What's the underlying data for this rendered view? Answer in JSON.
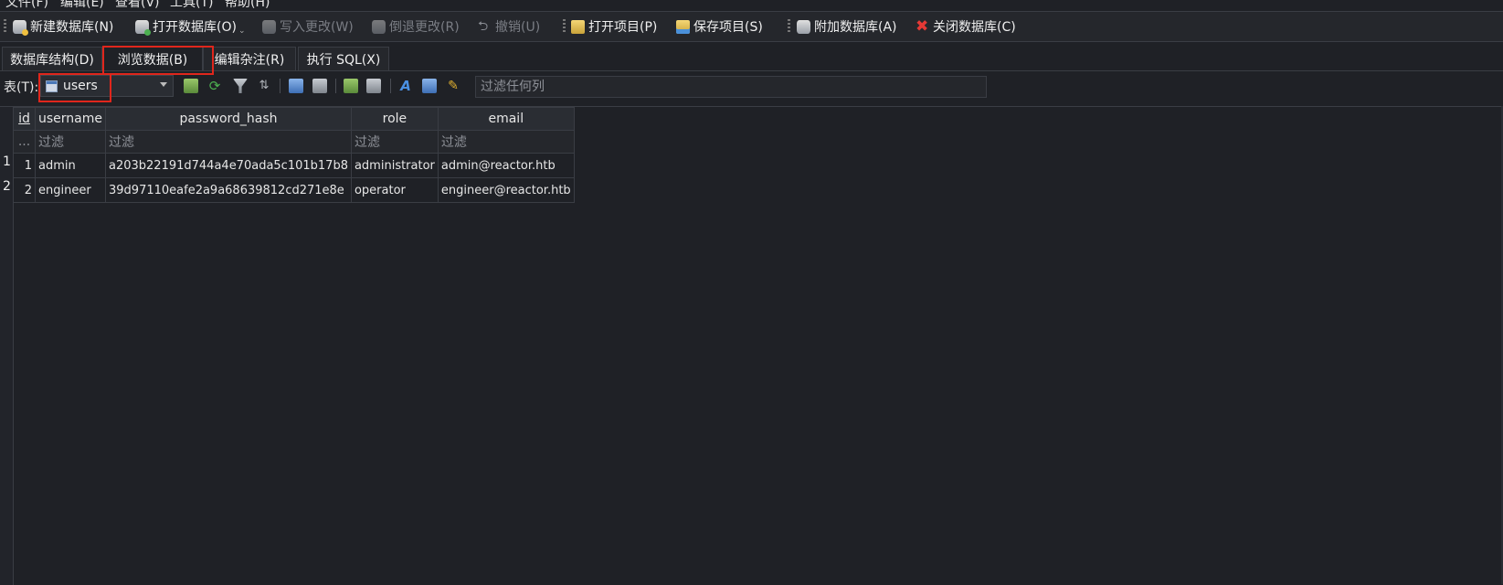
{
  "menu": [
    "文件(F)",
    "编辑(E)",
    "查看(V)",
    "工具(T)",
    "帮助(H)"
  ],
  "toolbar": {
    "new_db": "新建数据库(N)",
    "open_db": "打开数据库(O)",
    "write_changes": "写入更改(W)",
    "revert_changes": "倒退更改(R)",
    "undo": "撤销(U)",
    "open_project": "打开项目(P)",
    "save_project": "保存项目(S)",
    "attach_db": "附加数据库(A)",
    "close_db": "关闭数据库(C)"
  },
  "tabs": [
    "数据库结构(D)",
    "浏览数据(B)",
    "编辑杂注(R)",
    "执行 SQL(X)"
  ],
  "browse": {
    "table_label": "表(T):",
    "selected_table": "users",
    "filter_any_placeholder": "过滤任何列"
  },
  "grid": {
    "columns": [
      "id",
      "username",
      "password_hash",
      "role",
      "email"
    ],
    "filter_placeholder": "过滤",
    "filter_rownum": "...",
    "rows": [
      {
        "row": "1",
        "id": "1",
        "username": "admin",
        "password_hash": "a203b22191d744a4e70ada5c101b17b8",
        "role": "administrator",
        "email": "admin@reactor.htb"
      },
      {
        "row": "2",
        "id": "2",
        "username": "engineer",
        "password_hash": "39d97110eafe2a9a68639812cd271e8e",
        "role": "operator",
        "email": "engineer@reactor.htb"
      }
    ]
  }
}
